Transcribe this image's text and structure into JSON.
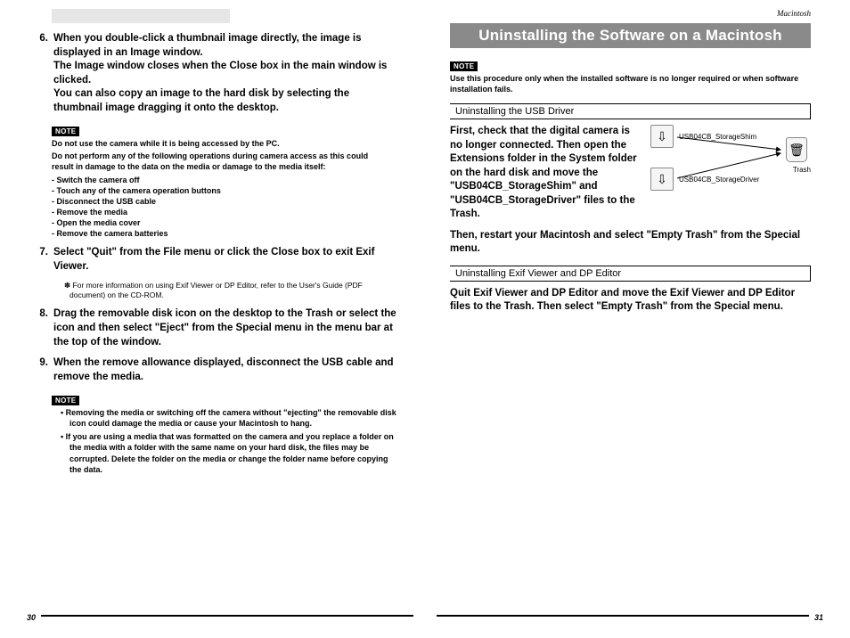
{
  "header": {
    "macintosh": "Macintosh"
  },
  "left": {
    "item6": "When you double-click a thumbnail image directly, the image is displayed in an Image window.\nThe Image window closes when the Close box in the main window is clicked.\nYou can also copy an image to the hard disk by selecting the thumbnail image dragging it onto the desktop.",
    "note1_badge": "NOTE",
    "note1_line1": "Do not use the camera while it is being accessed by the PC.",
    "note1_line2": "Do not perform any of the following operations during camera access as this could result in damage to the data on the media or damage to the media itself:",
    "note1_bullets": [
      "- Switch the camera off",
      "- Touch any of the camera operation buttons",
      "- Disconnect the USB cable",
      "- Remove the media",
      "- Open the media cover",
      "- Remove the camera batteries"
    ],
    "item7": "Select \"Quit\" from the File menu or click the Close box to exit Exif Viewer.",
    "item7_note": "✽ For more information on using Exif Viewer or DP Editor, refer to the User's Guide (PDF document) on the CD-ROM.",
    "item8": "Drag the removable disk icon on the desktop to the Trash or select the icon and then select \"Eject\" from the Special menu in the menu bar at the top of the window.",
    "item9": "When the remove allowance displayed, disconnect the USB cable and remove the media.",
    "note2_badge": "NOTE",
    "note2_b1": "• Removing the media or switching off the camera without \"ejecting\" the removable disk icon could damage the media or cause your Macintosh to hang.",
    "note2_b2": "• If you are using a media that was formatted on the camera and you replace a folder on the media with a folder with the same name on your hard disk, the files may be corrupted. Delete the folder on the media or change the folder name before copying the data.",
    "page_num": "30"
  },
  "right": {
    "title": "Uninstalling the Software on a Macintosh",
    "note_badge": "NOTE",
    "note_text": "Use this procedure only when the installed software is no longer required or when software installation fails.",
    "section1": "Uninstalling the USB Driver",
    "usb_text": "First, check that the digital camera is no longer connected. Then open the Extensions folder in the System folder on the hard disk and move the \"USB04CB_StorageShim\" and \"USB04CB_StorageDriver\" files to the Trash.",
    "usb_after": "Then, restart your Macintosh and select \"Empty Trash\" from the Special menu.",
    "icon1_label": "USB04CB_StorageShim",
    "icon2_label": "USB04CB_StorageDriver",
    "trash_label": "Trash",
    "section2": "Uninstalling Exif Viewer and DP Editor",
    "exif_text": "Quit Exif Viewer and DP Editor and move the Exif Viewer and DP Editor files to the Trash. Then select \"Empty Trash\" from the Special menu.",
    "page_num": "31"
  }
}
